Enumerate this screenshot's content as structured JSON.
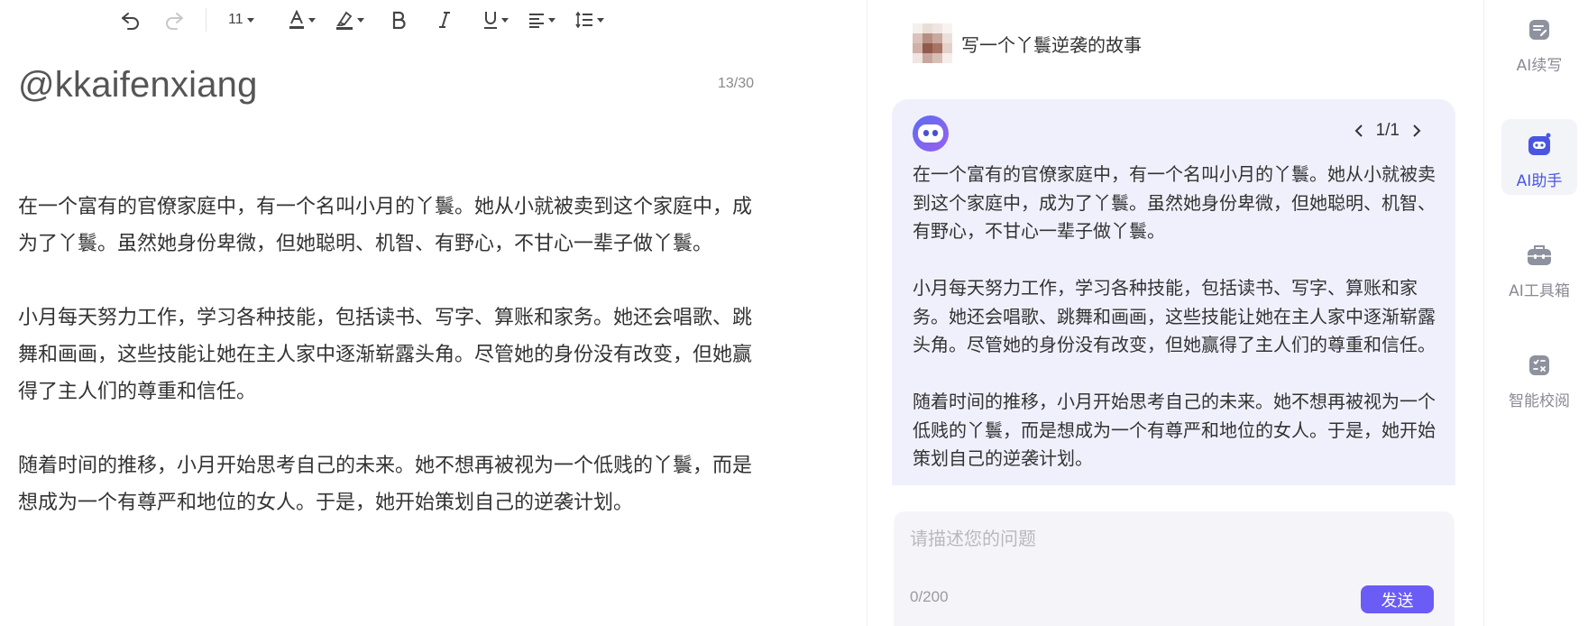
{
  "toolbar": {
    "font_size": "11",
    "icons": [
      "undo-icon",
      "redo-icon",
      "font-color-icon",
      "highlight-icon",
      "bold-icon",
      "italic-icon",
      "underline-icon",
      "align-icon",
      "line-spacing-icon"
    ]
  },
  "document": {
    "title": "@kkaifenxiang",
    "title_count": "13/30",
    "paragraphs": [
      "在一个富有的官僚家庭中，有一个名叫小月的丫鬟。她从小就被卖到这个家庭中，成为了丫鬟。虽然她身份卑微，但她聪明、机智、有野心，不甘心一辈子做丫鬟。",
      "小月每天努力工作，学习各种技能，包括读书、写字、算账和家务。她还会唱歌、跳舞和画画，这些技能让她在主人家中逐渐崭露头角。尽管她的身份没有改变，但她赢得了主人们的尊重和信任。",
      "随着时间的推移，小月开始思考自己的未来。她不想再被视为一个低贱的丫鬟，而是想成为一个有尊严和地位的女人。于是，她开始策划自己的逆袭计划。"
    ]
  },
  "assistant": {
    "question": "写一个丫鬟逆袭的故事",
    "pager": "1/1",
    "answer_paragraphs": [
      "在一个富有的官僚家庭中，有一个名叫小月的丫鬟。她从小就被卖到这个家庭中，成为了丫鬟。虽然她身份卑微，但她聪明、机智、有野心，不甘心一辈子做丫鬟。",
      "小月每天努力工作，学习各种技能，包括读书、写字、算账和家务。她还会唱歌、跳舞和画画，这些技能让她在主人家中逐渐崭露头角。尽管她的身份没有改变，但她赢得了主人们的尊重和信任。",
      "随着时间的推移，小月开始思考自己的未来。她不想再被视为一个低贱的丫鬟，而是想成为一个有尊严和地位的女人。于是，她开始策划自己的逆袭计划。"
    ],
    "input_placeholder": "请描述您的问题",
    "char_count": "0/200",
    "send_label": "发送"
  },
  "sidenav": {
    "items": [
      {
        "label": "AI续写",
        "icon": "ai-continue-write-icon",
        "active": false
      },
      {
        "label": "AI助手",
        "icon": "ai-assistant-robot-icon",
        "active": true
      },
      {
        "label": "AI工具箱",
        "icon": "ai-toolbox-icon",
        "active": false
      },
      {
        "label": "智能校阅",
        "icon": "smart-proofread-icon",
        "active": false
      }
    ]
  },
  "colors": {
    "accent": "#4a56e2",
    "send_button": "#6b5cf6",
    "answer_card_bg": "#f0f0fd",
    "input_bg": "#f5f5f9"
  }
}
